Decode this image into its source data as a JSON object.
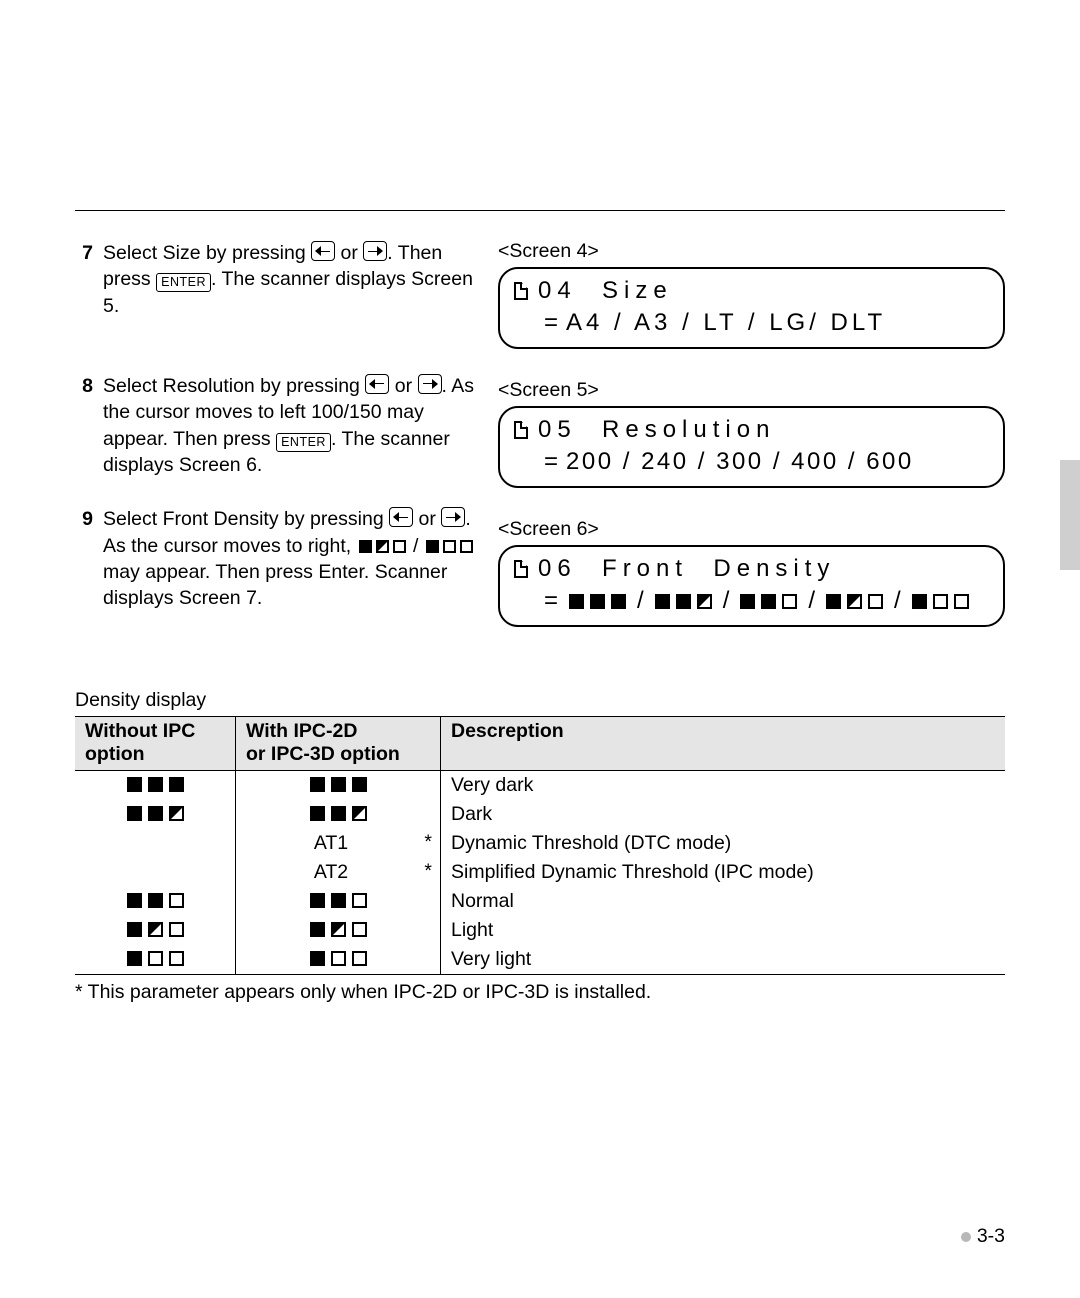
{
  "steps": [
    {
      "num": "7",
      "text_pre": "Select Size by pressing ",
      "key1": "left",
      "mid1": " or ",
      "key2": "right",
      "mid2": ". Then press ",
      "key3": "ENTER",
      "text_post": ". The scanner displays Screen 5."
    },
    {
      "num": "8",
      "text_pre": "Select Resolution by pressing ",
      "key1": "left",
      "mid1": " or ",
      "key2": "right",
      "mid2": ". As the cursor moves to left 100/150 may appear. Then press ",
      "key3": "ENTER",
      "text_post": ". The scanner displays Screen 6."
    },
    {
      "num": "9",
      "text_pre": "Select Front Density by pressing ",
      "key1": "left",
      "mid1": " or ",
      "key2": "right",
      "mid2": ". As the cursor moves to right, ",
      "inline_dens_1": [
        "f",
        "h",
        "e"
      ],
      "mid3": " / ",
      "inline_dens_2": [
        "f",
        "e",
        "e"
      ],
      "text_post": " may appear. Then press Enter. Scanner displays Screen 7."
    }
  ],
  "screens": [
    {
      "label": "<Screen 4>",
      "line1": "04  Size",
      "line2_type": "text",
      "line2": "A4 / A3 / LT / LG/ DLT"
    },
    {
      "label": "<Screen 5>",
      "line1": "05  Resolution",
      "line2_type": "text",
      "line2": "200 / 240 / 300 / 400 / 600",
      "tight": true
    },
    {
      "label": "<Screen 6>",
      "line1": "06  Front  Density",
      "line2_type": "density",
      "density_groups": [
        [
          "f",
          "f",
          "f"
        ],
        [
          "f",
          "f",
          "h"
        ],
        [
          "f",
          "f",
          "e"
        ],
        [
          "f",
          "h",
          "e"
        ],
        [
          "f",
          "e",
          "e"
        ]
      ]
    }
  ],
  "density_table": {
    "heading": "Density display",
    "col1a": "Without IPC",
    "col1b": "option",
    "col2a": "With IPC-2D",
    "col2b": "or IPC-3D option",
    "col3": "Descreption",
    "rows": [
      {
        "w": [
          "f",
          "f",
          "f"
        ],
        "i": {
          "kind": "sq",
          "v": [
            "f",
            "f",
            "f"
          ]
        },
        "d": "Very dark"
      },
      {
        "w": [
          "f",
          "f",
          "h"
        ],
        "i": {
          "kind": "sq",
          "v": [
            "f",
            "f",
            "h"
          ]
        },
        "d": "Dark"
      },
      {
        "w": null,
        "i": {
          "kind": "at",
          "v": "AT1",
          "ast": "*"
        },
        "d": "Dynamic Threshold (DTC mode)"
      },
      {
        "w": null,
        "i": {
          "kind": "at",
          "v": "AT2",
          "ast": "*"
        },
        "d": "Simplified Dynamic Threshold (IPC mode)"
      },
      {
        "w": [
          "f",
          "f",
          "e"
        ],
        "i": {
          "kind": "sq",
          "v": [
            "f",
            "f",
            "e"
          ]
        },
        "d": "Normal"
      },
      {
        "w": [
          "f",
          "h",
          "e"
        ],
        "i": {
          "kind": "sq",
          "v": [
            "f",
            "h",
            "e"
          ]
        },
        "d": "Light"
      },
      {
        "w": [
          "f",
          "e",
          "e"
        ],
        "i": {
          "kind": "sq",
          "v": [
            "f",
            "e",
            "e"
          ]
        },
        "d": "Very light"
      }
    ],
    "footnote": "* This parameter appears only when IPC-2D or IPC-3D is installed."
  },
  "page_number": "3-3",
  "enter_label": "ENTER"
}
